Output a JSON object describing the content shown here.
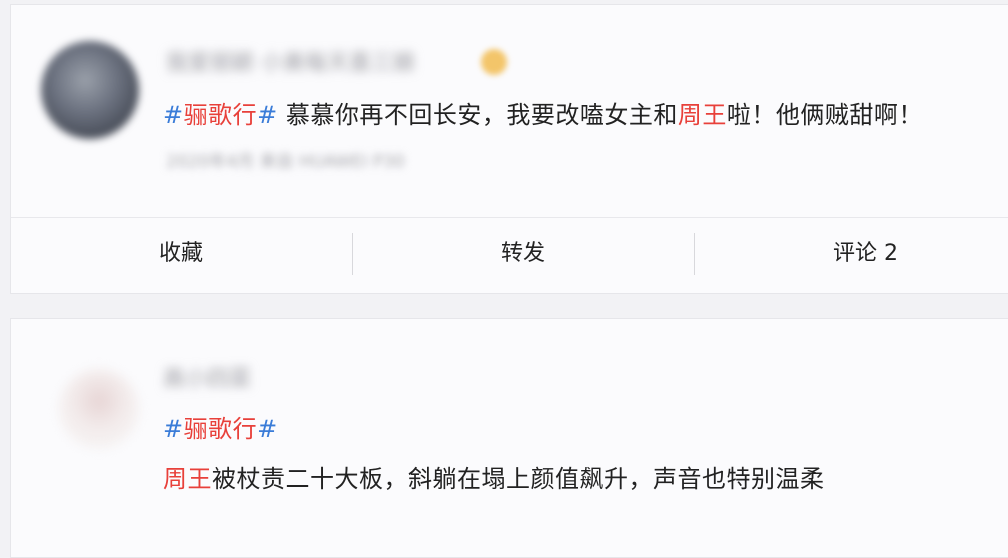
{
  "posts": [
    {
      "username": "我爱丽颖 小美每天喜三娘",
      "meta": "2020年4月 来自 HUAWEI P30",
      "hash": "#",
      "topic": "骊歌行",
      "text_parts": [
        "慕慕你再不回长安，我要改嗑女主和",
        "周王",
        "啦！他俩贼甜啊！"
      ],
      "actions": {
        "favorite": "收藏",
        "repost": "转发",
        "comment": "评论 2"
      }
    },
    {
      "username": "高小四菜",
      "hash": "#",
      "topic": "骊歌行",
      "text_red": "周王",
      "text_rest": "被杖责二十大板，斜躺在塌上颜值飙升，声音也特别温柔"
    }
  ]
}
